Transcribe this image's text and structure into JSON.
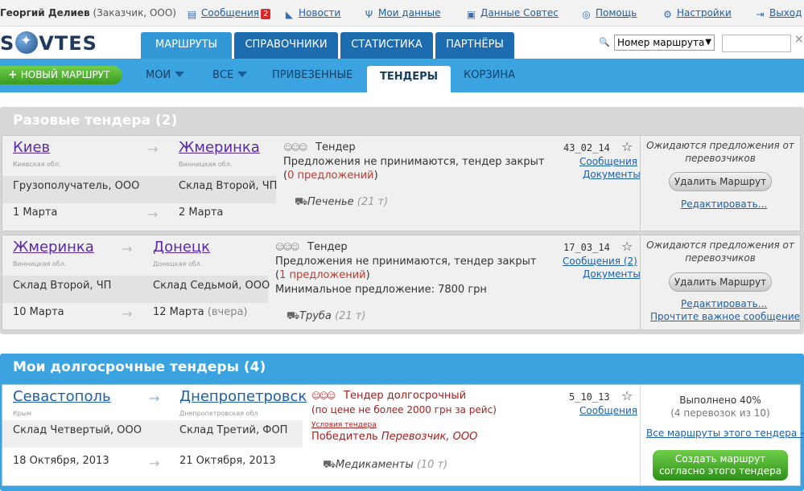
{
  "topbar": {
    "user_name": "Георгий Делиев",
    "user_role": "(Заказчик, ООО)",
    "links": [
      {
        "label": "Сообщения",
        "badge": "2",
        "icon": "messages-icon"
      },
      {
        "label": "Новости",
        "icon": "rss-icon"
      },
      {
        "label": "Мои данные",
        "icon": "emblem-icon"
      },
      {
        "label": "Данные Совтес",
        "icon": "document-icon"
      },
      {
        "label": "Помощь",
        "icon": "lifebuoy-icon"
      },
      {
        "label": "Настройки",
        "icon": "gear-icon"
      },
      {
        "label": "Выход",
        "icon": "logout-icon"
      }
    ]
  },
  "header": {
    "logo": "SOVTES",
    "logo_left": "S",
    "logo_right": "VTES",
    "tabs": [
      "МАРШРУТЫ",
      "СПРАВОЧНИКИ",
      "СТАТИСТИКА",
      "ПАРТНЁРЫ"
    ],
    "search_select": "Номер маршрута",
    "search_value": ""
  },
  "subnav": {
    "new_route": "НОВЫЙ МАРШРУТ",
    "tabs": [
      "МОИ",
      "ВСЕ",
      "ПРИВЕЗЕННЫЕ",
      "ТЕНДЕРЫ",
      "КОРЗИНА"
    ]
  },
  "one_time": {
    "title": "Разовые тендера (2)",
    "cards": [
      {
        "from_city": "Киев",
        "from_region": "Киевская обл.",
        "to_city": "Жмеринка",
        "to_region": "Винницкая обл.",
        "from_party": "Грузополучатель, ООО",
        "to_party": "Склад Второй, ЧП",
        "from_date": "1 Марта",
        "to_date": "2 Марта",
        "to_date_note": "",
        "tender_label": "Тендер",
        "status": "Предложения не принимаются, тендер закрыт",
        "offers_open": "(",
        "offers_link": "0 предложений",
        "offers_close": ")",
        "min_offer": "",
        "cargo": "Печенье",
        "weight": "(21 т)",
        "code": "43_02_14",
        "messages": "Сообщения",
        "documents": "Документы",
        "wait": "Ожидаются предложения от перевозчиков",
        "delete": "Удалить Маршрут",
        "edit": "Редактировать...",
        "important": ""
      },
      {
        "from_city": "Жмеринка",
        "from_region": "Винницкая обл.",
        "to_city": "Донецк",
        "to_region": "Донецкая обл.",
        "from_party": "Склад Второй, ЧП",
        "to_party": "Склад Седьмой, ООО",
        "from_date": "10 Марта",
        "to_date": "12 Марта",
        "to_date_note": "(вчера)",
        "tender_label": "Тендер",
        "status": "Предложения не принимаются, тендер закрыт",
        "offers_open": "(",
        "offers_link": "1 предложений",
        "offers_close": ")",
        "min_offer": "Минимальное предложение: 7800 грн",
        "cargo": "Труба",
        "weight": "(21 т)",
        "code": "17_03_14",
        "messages": "Сообщения (2)",
        "documents": "Документы",
        "wait": "Ожидаются предложения от перевозчиков",
        "delete": "Удалить Маршрут",
        "edit": "Редактировать...",
        "important": "Прочтите важное сообщение"
      }
    ]
  },
  "long_term": {
    "title": "Мои долгосрочные тендеры (4)",
    "cards": [
      {
        "from_city": "Севастополь",
        "from_region": "Крым",
        "to_city": "Днепропетровск",
        "to_region": "Днепропетровская обл.",
        "from_party": "Склад Четвертый, ООО",
        "to_party": "Склад Третий, ФОП",
        "from_date": "18 Октября, 2013",
        "to_date": "21 Октября, 2013",
        "tender_label": "Тендер долгосрочный",
        "price_note": "(по цене не более 2000 грн за рейс)",
        "conditions": "Условия тендера",
        "winner_label": "Победитель",
        "winner": "Перевозчик, ООО",
        "cargo": "Медикаменты",
        "weight": "(10 т)",
        "code": "5_10_13",
        "messages": "Сообщения",
        "done": "Выполнено 40%",
        "done_detail": "(4 перевозок из 10)",
        "all_routes": "Все маршруты этого тендера →",
        "create_line1": "Создать маршрут",
        "create_line2": "согласно этого тендера"
      }
    ]
  },
  "colors": {
    "accent": "#3aa3e0",
    "tab_dark": "#1e6cb0",
    "green": "#3a9a1f",
    "offer_red": "#c0392b"
  }
}
